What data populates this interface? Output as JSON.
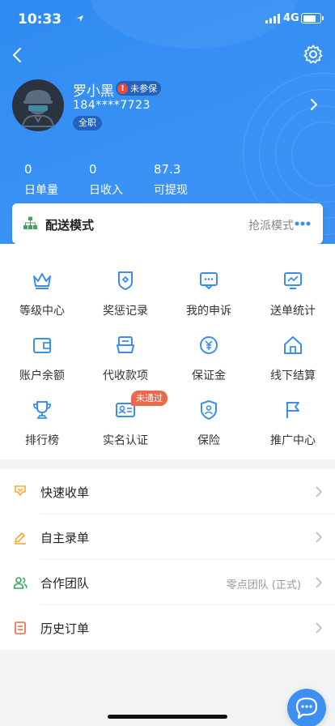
{
  "status_bar": {
    "time": "10:33",
    "network": "4G",
    "battery_level": 0.8
  },
  "profile": {
    "name": "罗小黑",
    "insurance_badge": "未参保",
    "insurance_warn": "!",
    "phone": "184****7723",
    "job_type": "全职"
  },
  "stats": [
    {
      "value": "0",
      "label": "日单量"
    },
    {
      "value": "0",
      "label": "日收入"
    },
    {
      "value": "87.3",
      "label": "可提现"
    }
  ],
  "delivery_mode": {
    "label": "配送模式",
    "value": "抢派模式"
  },
  "grid": [
    {
      "label": "等级中心",
      "icon": "crown-icon"
    },
    {
      "label": "奖惩记录",
      "icon": "shield-badge-icon"
    },
    {
      "label": "我的申诉",
      "icon": "message-icon"
    },
    {
      "label": "送单统计",
      "icon": "chart-monitor-icon"
    },
    {
      "label": "账户余额",
      "icon": "wallet-icon"
    },
    {
      "label": "代收款项",
      "icon": "card-stack-icon"
    },
    {
      "label": "保证金",
      "icon": "yen-coin-icon"
    },
    {
      "label": "线下结算",
      "icon": "house-icon"
    },
    {
      "label": "排行榜",
      "icon": "trophy-icon"
    },
    {
      "label": "实名认证",
      "icon": "id-card-icon"
    },
    {
      "label": "保险",
      "icon": "shield-person-icon"
    },
    {
      "label": "推广中心",
      "icon": "flag-icon"
    }
  ],
  "verify_tag": "未通过",
  "menu": [
    {
      "label": "快速收单",
      "value": "",
      "icon": "quick-receive-icon",
      "color": "#f2a93b"
    },
    {
      "label": "自主录单",
      "value": "",
      "icon": "pencil-icon",
      "color": "#f2a93b"
    },
    {
      "label": "合作团队",
      "value": "零点团队 (正式)",
      "icon": "team-icon",
      "color": "#3aa85b"
    },
    {
      "label": "历史订单",
      "value": "",
      "icon": "order-history-icon",
      "color": "#e36b3c"
    }
  ],
  "colors": {
    "primary": "#3a92f5",
    "icon_blue": "#3c8df0",
    "badge_red": "#e96a4c"
  }
}
